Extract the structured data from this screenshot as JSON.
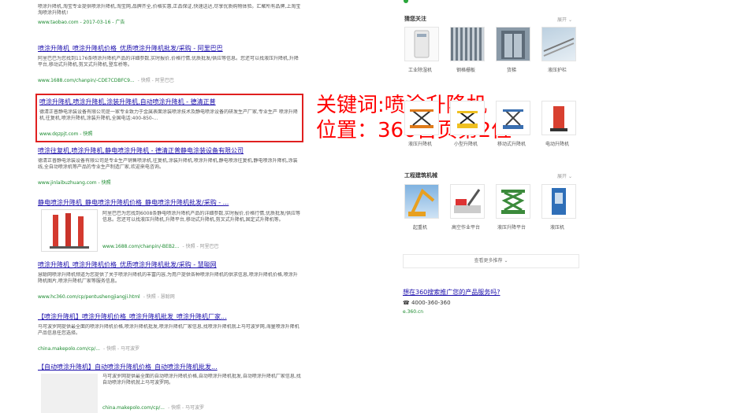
{
  "results": [
    {
      "title": "",
      "desc": "喷涂升降机,淘宝专业提供喷涂升降机,淘宝网,品牌齐全,价格实惠,正品保证,快速送达,尽享优质购物体验。汇聚所有品牌,上淘宝淘喷涂升降机!",
      "url": "www.taobao.com - 2017-03-16 - 广告"
    },
    {
      "title": "喷涂升降机_喷涂升降机价格_优质喷涂升降机批发/采购 - 阿里巴巴",
      "desc": "阿里巴巴为您找到1176条喷涂升降机产品的详细参数,实时报价,价格行情,优质批发/供应等信息。您还可以找液压升降机,升降平台,移动式升降机,剪叉式升降机,登车桥等。",
      "url": "www.1688.com/chanpin/-CDE7CDBFC9...",
      "extra": "- 快照 - 阿里巴巴"
    },
    {
      "title": "喷涂升降机,喷涂升降机,涂装升降机,自动喷涂升降机 - 德清正普",
      "desc": "德清正普静电涂装设备有限公司是一家专业致力于金属表面涂装喷涂技术及静电喷涂设备的研发生产厂家,专业生产 喷涂升降机,往复机,喷涂升降机,涂装升降机,全国电话:400-850-...",
      "url": "www.dqzpjt.com - 快照"
    },
    {
      "title": "喷涂往复机,喷涂升降机,静电喷涂升降机 - 德清正普静电涂装设备有限公司",
      "desc": "德清正普静电涂装设备有限公司是专业生产销售喷涂机,往复机,涂装升降机,喷涂升降机,静电喷涂往复机,静电喷涂升降机,涂装线,全自动喷涂机等产品的专业生产制造厂家,欢迎来电咨询。",
      "url": "www.jinlaibuzhuang.com - 快照"
    },
    {
      "title": "静电喷涂升降机_静电喷涂升降机价格_静电喷涂升降机批发/采购 - ...",
      "desc": "阿里巴巴为您找到6008条静电喷涂升降机产品的详细参数,实时报价,价格行情,优质批发/供应等信息。您还可以找液压升降机,升降平台,移动式升降机,剪叉式升降机,固定式升降机等。",
      "url": "www.1688.com/chanpin/-BEB2...",
      "extra": "- 快照 - 阿里巴巴"
    },
    {
      "title": "喷涂升降机_喷涂升降机价格_优质喷涂升降机批发/采购 - 慧聪网",
      "desc": "慧聪网喷涂升降机频道为您提供了关于喷涂升降机的丰富内容,为用户提供各种喷涂升降机的供求信息,喷涂升降机价格,喷涂升降机图片,喷涂升降机厂家等服务信息。",
      "url": "www.hc360.com/cp/pentushengjiangji.html",
      "extra": "- 快照 - 慧聪网"
    },
    {
      "title": "【喷涂升降机】喷涂升降机价格_喷涂升降机批发_喷涂升降机厂家...",
      "desc": "马可波罗网提供最全面的喷涂升降机价格,喷涂升降机批发,喷涂升降机厂家信息,找喷涂升降机就上马可波罗网,海量喷涂升降机产品信息任您选择。",
      "url": "china.makepolo.com/cp/...",
      "extra": "- 快照 - 马可波罗"
    },
    {
      "title": "【自动喷涂升降机】自动喷涂升降机价格_自动喷涂升降机批发...",
      "desc": "马可波罗网提供最全面的自动喷涂升降机价格,自动喷涂升降机批发,自动喷涂升降机厂家信息,找自动喷涂升降机就上马可波罗网。",
      "url": "china.makepolo.com/cp/...",
      "extra": "- 快照 - 马可波罗"
    }
  ],
  "annotation": {
    "line1": "关键词:喷涂升降机",
    "line2": "位置：360首页第2位"
  },
  "sidebar": {
    "section1": {
      "title": "猜您关注",
      "more": "展开",
      "row1": [
        "工业除湿机",
        "钢格栅板",
        "货梯",
        "液压护栏"
      ],
      "row2": [
        "液压升降机",
        "小型升降机",
        "移动式升降机",
        "电动升降机"
      ]
    },
    "section2": {
      "title": "工程建筑机械",
      "more": "展开",
      "items": [
        "起重机",
        "高空作业平台",
        "液压升降平台",
        "液压机"
      ]
    },
    "view_more": "查看更多推荐",
    "ad": {
      "title": "想在360搜索推广您的产品服务吗?",
      "phone": "☎ 4000-360-360",
      "url": "e.360.cn"
    }
  }
}
